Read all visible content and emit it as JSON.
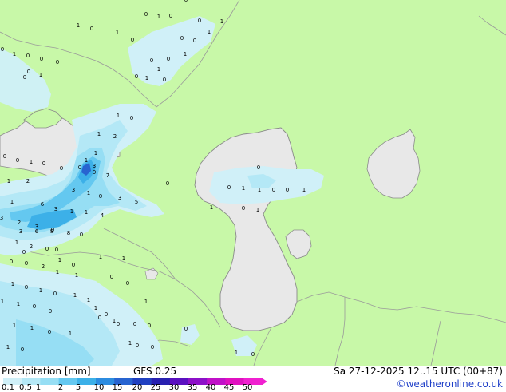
{
  "footer": {
    "title": "Precipitation [mm]",
    "model": "GFS 0.25",
    "datetime": "Sa 27-12-2025 12..15 UTC (00+87)",
    "credit": "©weatheronline.co.uk"
  },
  "legend": {
    "labels": [
      "0.1",
      "0.5",
      "1",
      "2",
      "5",
      "10",
      "15",
      "20",
      "25",
      "30",
      "35",
      "40",
      "45",
      "50"
    ],
    "colors": [
      "#d0f0f8",
      "#b4e8f6",
      "#96def4",
      "#64c8f0",
      "#3cb0e8",
      "#2c8ce0",
      "#2864d0",
      "#2040c0",
      "#2820b0",
      "#5a10c0",
      "#8c10c8",
      "#c010c8",
      "#e010c0",
      "#f020d0"
    ]
  },
  "map": {
    "colors": {
      "land": "#c8f8a8",
      "water": "#e8e8e8",
      "border": "#9a9a9a",
      "coast": "#8a8a8a"
    },
    "values": [
      "0",
      "1",
      "0",
      "0",
      "0",
      "1",
      "1",
      "0",
      "0",
      "1",
      "0",
      "1",
      "0",
      "0",
      "1",
      "0",
      "1",
      "0",
      "1",
      "0",
      "0",
      "1",
      "0",
      "0",
      "0",
      "0",
      "1",
      "0",
      "1",
      "0",
      "1",
      "2",
      "1",
      "0",
      "0",
      "1",
      "3",
      "7",
      "0",
      "0",
      "1",
      "0",
      "0",
      "1",
      "2",
      "3",
      "1",
      "0",
      "3",
      "5",
      "1",
      "6",
      "3",
      "1",
      "1",
      "4",
      "3",
      "2",
      "3",
      "0",
      "3",
      "6",
      "8",
      "8",
      "0",
      "1",
      "2",
      "0",
      "0",
      "1",
      "1",
      "0",
      "0",
      "2",
      "1",
      "1",
      "1",
      "0",
      "1",
      "0",
      "1",
      "1",
      "1",
      "1",
      "0",
      "0",
      "0",
      "1",
      "0",
      "0",
      "1",
      "1",
      "0",
      "1",
      "1",
      "0",
      "0",
      "0",
      "0",
      "0",
      "0",
      "1",
      "0",
      "1",
      "0",
      "0",
      "1",
      "1",
      "0",
      "1",
      "1",
      "0",
      "1",
      "0",
      "0",
      "1",
      "1",
      "0",
      "0",
      "0",
      "1",
      "0",
      "0",
      "0",
      "0",
      "1",
      "0",
      "0",
      "0",
      "0",
      "0",
      "0"
    ]
  }
}
